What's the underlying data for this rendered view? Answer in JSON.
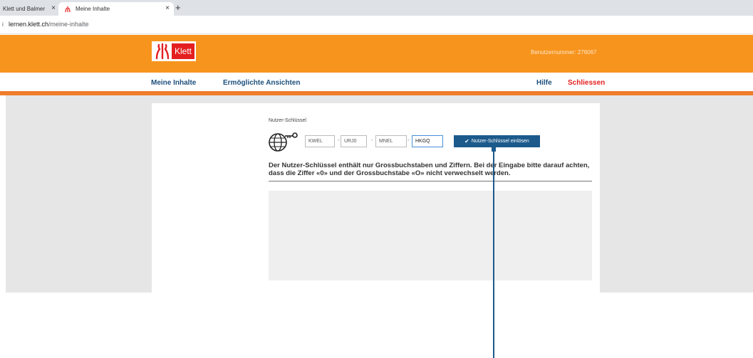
{
  "browser": {
    "tabs": [
      {
        "title": "Klett und Balmer",
        "active": false
      },
      {
        "title": "Meine Inhalte",
        "active": true
      }
    ],
    "close_glyph": "×",
    "new_tab_glyph": "+",
    "url_host": "lernen.klett.ch",
    "url_path": "/meine-inhalte"
  },
  "header": {
    "logo_text": "Klett",
    "user_number": "Benutzernummer: 276067",
    "accent_color": "#f7941d",
    "brand_red": "#e41f1f"
  },
  "nav": {
    "items": [
      {
        "label": "Meine Inhalte"
      },
      {
        "label": "Ermöglichte Ansichten"
      }
    ],
    "help_label": "Hilfe",
    "close_label": "Schliessen"
  },
  "main": {
    "key_label": "Nutzer-Schlüssel",
    "key_fields": [
      "KWEL",
      "URJ0",
      "MNEL",
      "HKGQ"
    ],
    "separator": "-",
    "redeem_label": "Nutzer-Schlüssel einlösen",
    "hint_text": "Der Nutzer-Schlüssel enthält nur Grossbuchstaben und Ziffern. Bei der Eingabe bitte darauf achten, dass die Ziffer «0» und der Grossbuchstabe «O» nicht verwechselt werden."
  }
}
